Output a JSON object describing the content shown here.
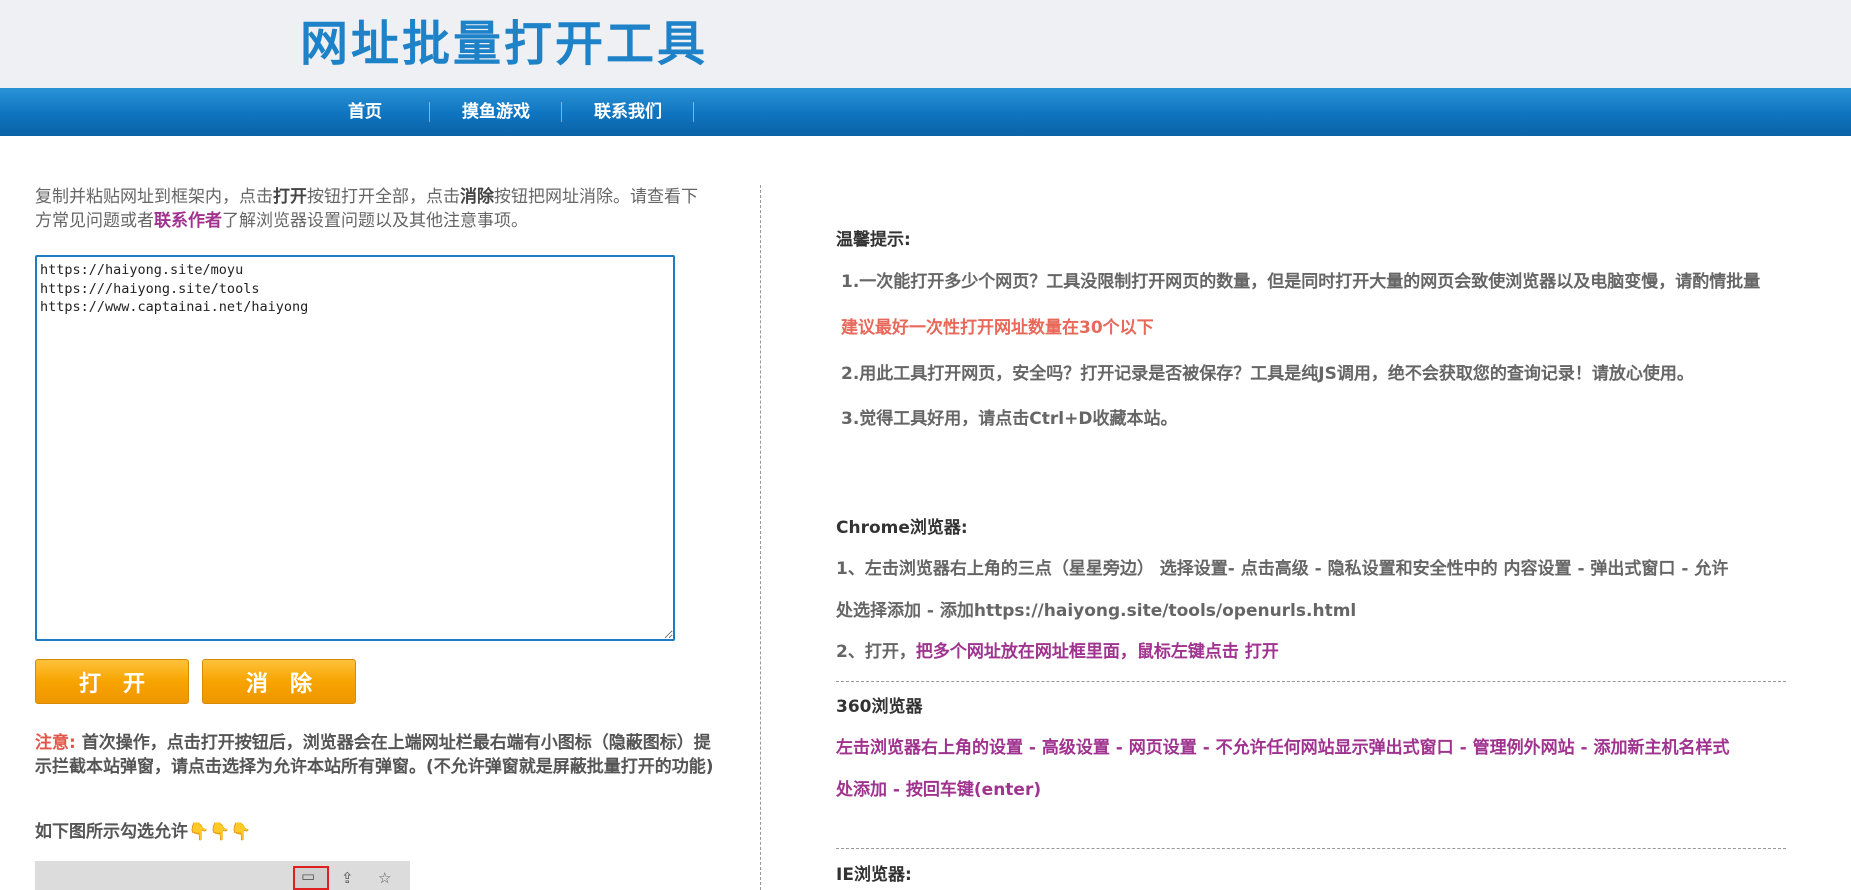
{
  "header": {
    "title": "网址批量打开工具",
    "nav": [
      {
        "label": "首页"
      },
      {
        "label": "摸鱼游戏"
      },
      {
        "label": "联系我们"
      }
    ]
  },
  "left": {
    "intro": {
      "p1": "复制并粘贴网址到框架内，点击",
      "open_word": "打开",
      "p2": "按钮打开全部，点击",
      "clear_word": "消除",
      "p3": "按钮把网址消除。请查看下方常见问题或者",
      "link": "联系作者",
      "p4": "了解浏览器设置问题以及其他注意事项。"
    },
    "textarea_value": "https://haiyong.site/moyu\nhttps:///haiyong.site/tools\nhttps://www.captainai.net/haiyong",
    "buttons": {
      "open": "打开",
      "clear": "消除"
    },
    "notice": {
      "label": "注意:",
      "text": " 首次操作，点击打开按钮后，浏览器会在上端网址栏最右端有小图标（隐蔽图标）提示拦截本站弹窗，请点击选择为允许本站所有弹窗。(不允许弹窗就是屏蔽批量打开的功能)"
    },
    "hint": "如下图所示勾选允许",
    "hint_hands": "👇👇👇"
  },
  "right": {
    "tips_title": "温馨提示:",
    "tip1": "1.一次能打开多少个网页？工具没限制打开网页的数量，但是同时打开大量的网页会致使浏览器以及电脑变慢，请酌情批量",
    "tip1_red": "建议最好一次性打开网址数量在30个以下",
    "tip2": "2.用此工具打开网页，安全吗？打开记录是否被保存？工具是纯JS调用，绝不会获取您的查询记录！请放心使用。",
    "tip3": "3.觉得工具好用，请点击Ctrl+D收藏本站。",
    "chrome_title": "Chrome浏览器:",
    "chrome_step1_a": "1、左击浏览器右上角的三点（星星旁边） 选择设置- 点击高级 - 隐私设置和安全性中的 内容设置 - 弹出式窗口 - 允许",
    "chrome_step1_b": "处选择添加 - 添加https://haiyong.site/tools/openurls.html",
    "chrome_step2_a": "2、打开，",
    "chrome_step2_b": "把多个网址放在网址框里面，鼠标左键点击 打开",
    "b360_title": "360浏览器",
    "b360_a": "左击浏览器右上角的设置 - 高级设置 - 网页设置 - 不允许任何网站显示弹出式窗口 - 管理例外网站 - 添加新主机名样式",
    "b360_b": "处添加 - 按回车键(enter)",
    "ie_title": "IE浏览器:"
  },
  "colors": {
    "brand_blue": "#1e82c8",
    "nav_blue": "#0f74bf",
    "button_orange": "#f7a400",
    "link_purple": "#a0338f",
    "warning_red": "#e8685a"
  }
}
